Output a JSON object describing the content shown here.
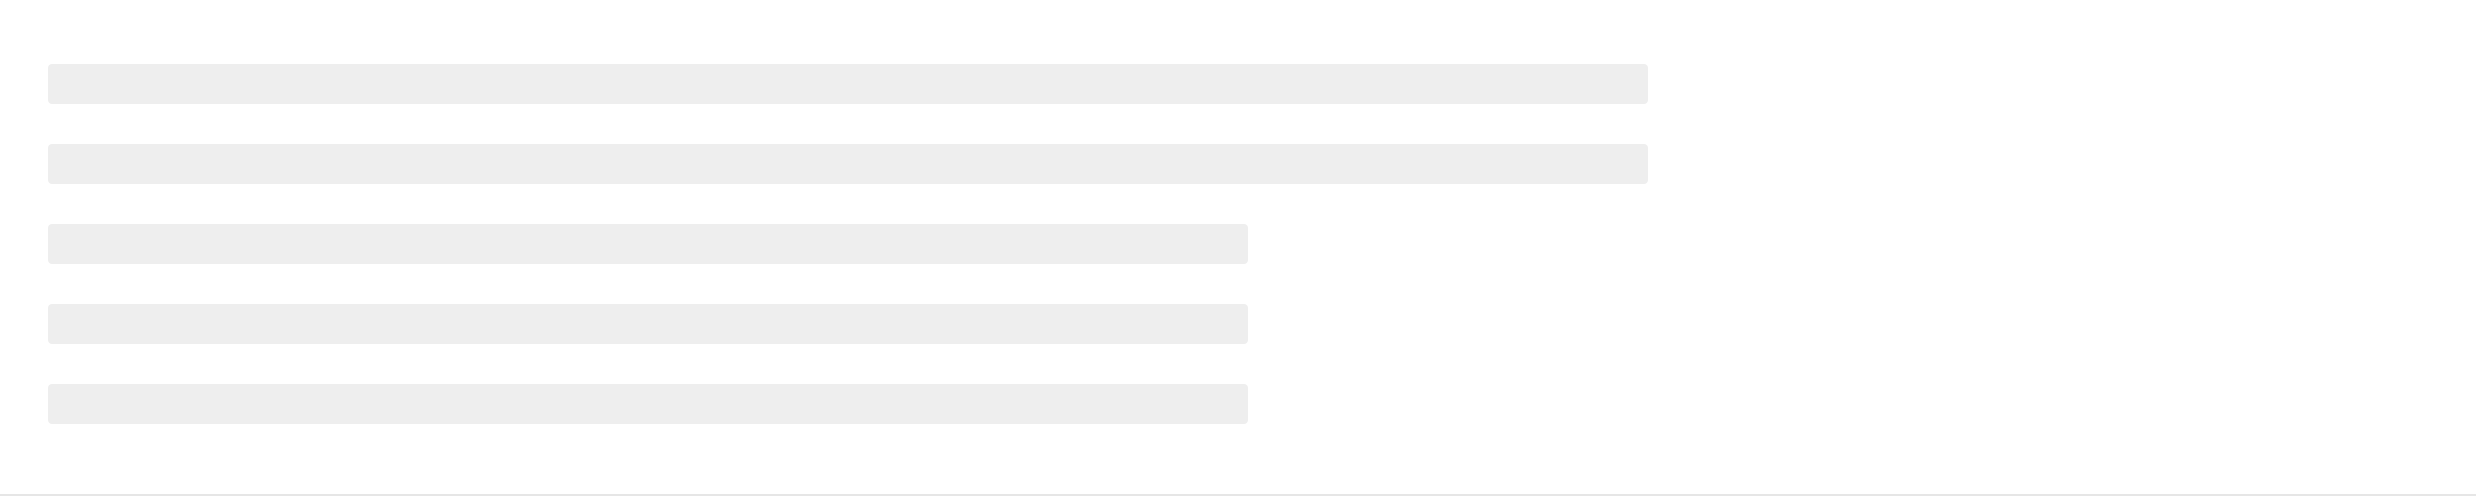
{
  "skeleton": {
    "color": "#eeeeee",
    "line_count": 5
  },
  "page": {
    "background": "#ffffff",
    "divider_color": "#e6e6e6"
  }
}
